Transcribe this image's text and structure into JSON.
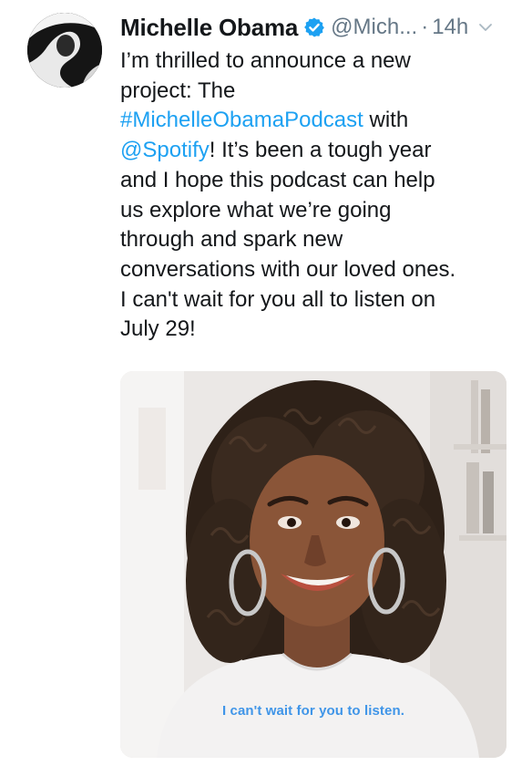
{
  "tweet": {
    "author": {
      "display_name": "Michelle Obama",
      "handle": "@Mich...",
      "verified": true,
      "avatar_icon": "profile-photo"
    },
    "separator": "·",
    "timestamp": "14h",
    "text_lines": [
      {
        "before": "I’m thrilled to announce a new",
        "link": "",
        "after": ""
      },
      {
        "before": "project: The",
        "link": "",
        "after": ""
      },
      {
        "before": "",
        "link": "#MichelleObamaPodcast",
        "after": " with"
      },
      {
        "before": "",
        "link": "@Spotify",
        "after": "! It’s been a tough year"
      },
      {
        "before": "and I hope this podcast can help",
        "link": "",
        "after": ""
      },
      {
        "before": "us explore what we’re going",
        "link": "",
        "after": ""
      },
      {
        "before": "through and spark new",
        "link": "",
        "after": ""
      },
      {
        "before": "conversations with our loved ones.",
        "link": "",
        "after": ""
      },
      {
        "before": "I can't wait for you all to listen on",
        "link": "",
        "after": ""
      },
      {
        "before": "July 29!",
        "link": "",
        "after": ""
      }
    ],
    "media": {
      "caption": "I can't wait for you to listen."
    }
  },
  "colors": {
    "link": "#1da1f2",
    "verified_badge": "#1da1f2",
    "muted_text": "#657786",
    "caption": "#3f95e8"
  }
}
